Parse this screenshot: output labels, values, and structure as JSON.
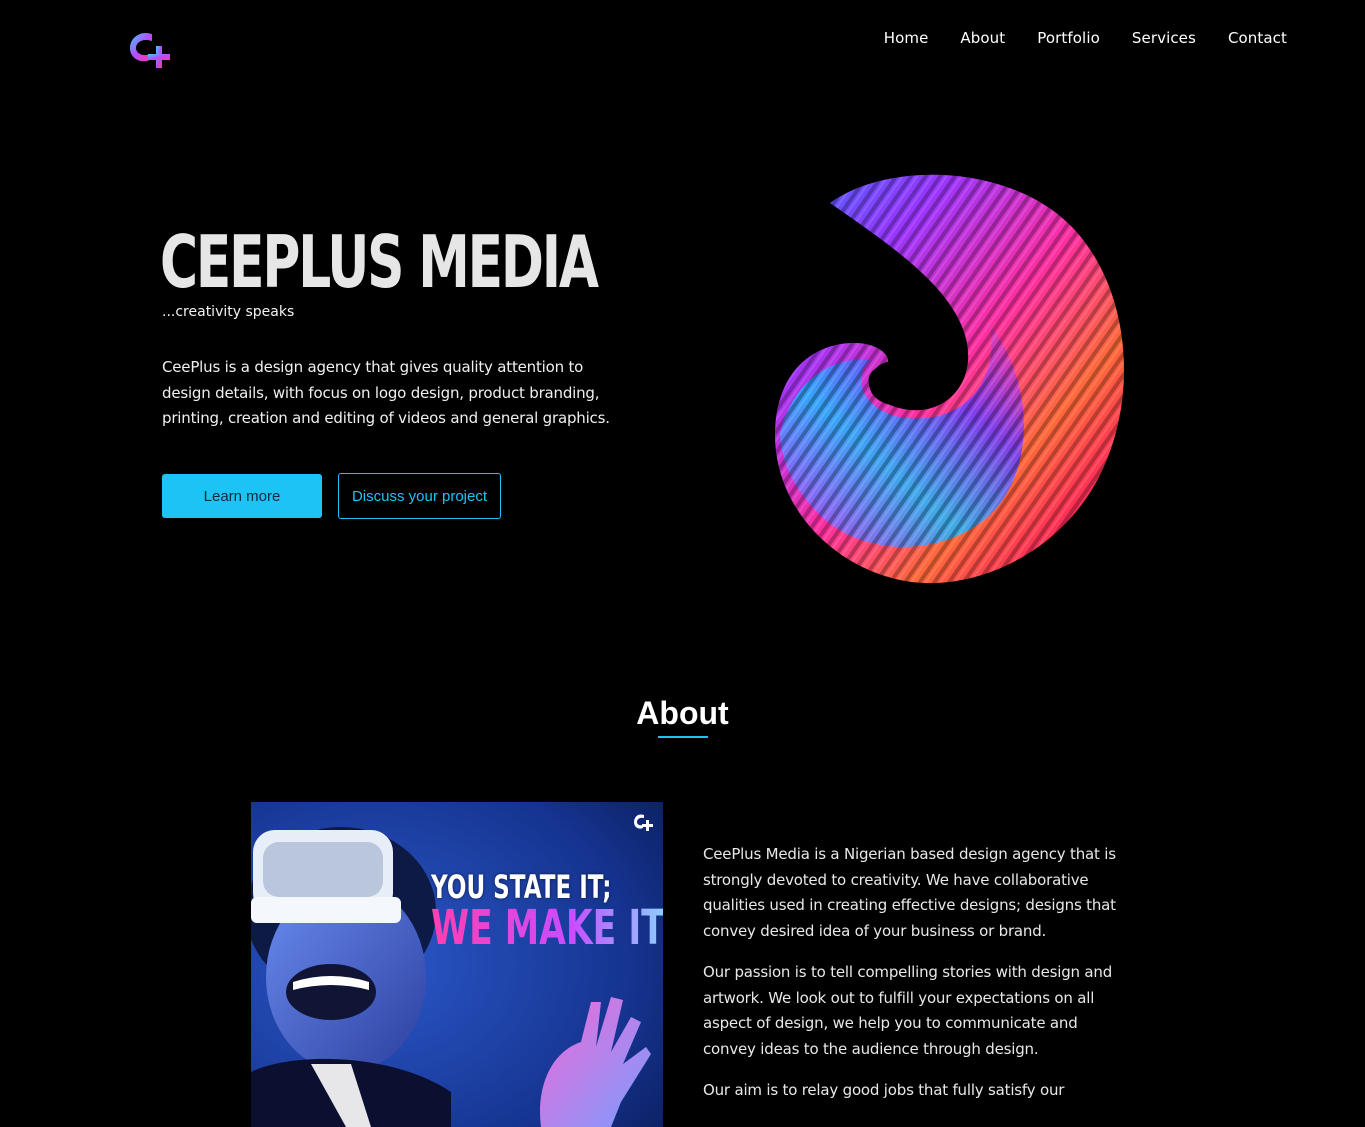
{
  "header": {
    "logo_text": "C+",
    "nav": [
      {
        "label": "Home"
      },
      {
        "label": "About"
      },
      {
        "label": "Portfolio"
      },
      {
        "label": "Services"
      },
      {
        "label": "Contact"
      }
    ]
  },
  "hero": {
    "title": "CEEPLUS MEDIA",
    "tagline": "...creativity speaks",
    "description": "CeePlus is a design agency that gives quality attention to design details, with focus on logo design, product branding, printing, creation and editing of videos and general graphics.",
    "primary_button": "Learn more",
    "secondary_button": "Discuss your project",
    "art_icon": "abstract-3d-swirl-art"
  },
  "about": {
    "heading": "About",
    "image": {
      "headline_line1": "YOU STATE IT;",
      "headline_line2": "WE MAKE IT",
      "subject_icon": "vr-headset-person-photo"
    },
    "paragraphs": [
      "CeePlus Media is a Nigerian based design agency that is strongly devoted to creativity. We have collaborative qualities used in creating effective designs; designs that convey desired idea of your business or brand.",
      "Our passion is to tell compelling stories with design and artwork. We look out to fulfill your expectations on all aspect of design, we help you to communicate and convey ideas to the audience through design.",
      "Our aim is to relay good jobs that fully satisfy our"
    ]
  },
  "colors": {
    "background": "#000000",
    "accent": "#1ec3f5",
    "text": "#ffffff"
  }
}
